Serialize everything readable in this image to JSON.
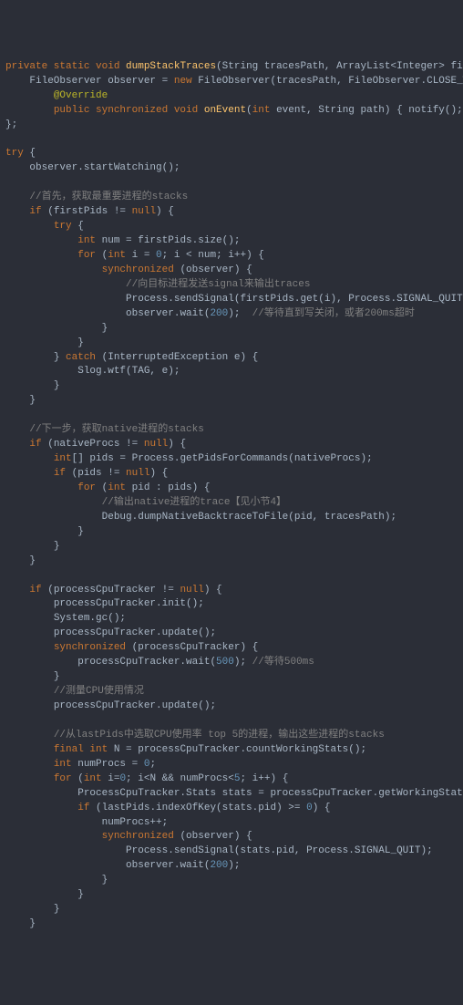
{
  "lines": [
    {
      "i": 0,
      "segs": [
        {
          "c": "kw",
          "t": "private static void "
        },
        {
          "c": "fn",
          "t": "dumpStackTraces"
        },
        {
          "c": "id",
          "t": "(String tracesPath, ArrayList<Integer> firstPids, ProcessC"
        }
      ]
    },
    {
      "i": 1,
      "segs": [
        {
          "c": "id",
          "t": "FileObserver observer = "
        },
        {
          "c": "kw",
          "t": "new "
        },
        {
          "c": "id",
          "t": "FileObserver(tracesPath, FileObserver.CLOSE_WRITE) {"
        }
      ]
    },
    {
      "i": 2,
      "segs": [
        {
          "c": "ann",
          "t": "@Override"
        }
      ]
    },
    {
      "i": 2,
      "segs": [
        {
          "c": "kw",
          "t": "public synchronized void "
        },
        {
          "c": "fn",
          "t": "onEvent"
        },
        {
          "c": "id",
          "t": "("
        },
        {
          "c": "kw",
          "t": "int "
        },
        {
          "c": "id",
          "t": "event, String path) { notify(); }"
        }
      ]
    },
    {
      "i": 0,
      "segs": [
        {
          "c": "id",
          "t": "};"
        }
      ]
    },
    {
      "i": 0,
      "segs": [
        {
          "c": "id",
          "t": " "
        }
      ]
    },
    {
      "i": 0,
      "segs": [
        {
          "c": "kw",
          "t": "try "
        },
        {
          "c": "id",
          "t": "{"
        }
      ]
    },
    {
      "i": 1,
      "segs": [
        {
          "c": "id",
          "t": "observer.startWatching();"
        }
      ]
    },
    {
      "i": 1,
      "segs": [
        {
          "c": "id",
          "t": " "
        }
      ]
    },
    {
      "i": 1,
      "segs": [
        {
          "c": "cm",
          "t": "//首先，获取最重要进程的stacks"
        }
      ]
    },
    {
      "i": 1,
      "segs": [
        {
          "c": "kw",
          "t": "if "
        },
        {
          "c": "id",
          "t": "(firstPids != "
        },
        {
          "c": "kw",
          "t": "null"
        },
        {
          "c": "id",
          "t": ") {"
        }
      ]
    },
    {
      "i": 2,
      "segs": [
        {
          "c": "kw",
          "t": "try "
        },
        {
          "c": "id",
          "t": "{"
        }
      ]
    },
    {
      "i": 3,
      "segs": [
        {
          "c": "kw",
          "t": "int "
        },
        {
          "c": "id",
          "t": "num = firstPids.size();"
        }
      ]
    },
    {
      "i": 3,
      "segs": [
        {
          "c": "kw",
          "t": "for "
        },
        {
          "c": "id",
          "t": "("
        },
        {
          "c": "kw",
          "t": "int "
        },
        {
          "c": "id",
          "t": "i = "
        },
        {
          "c": "num",
          "t": "0"
        },
        {
          "c": "id",
          "t": "; i < num; i++) {"
        }
      ]
    },
    {
      "i": 4,
      "segs": [
        {
          "c": "kw",
          "t": "synchronized "
        },
        {
          "c": "id",
          "t": "(observer) {"
        }
      ]
    },
    {
      "i": 5,
      "segs": [
        {
          "c": "cm",
          "t": "//向目标进程发送signal来输出traces"
        }
      ]
    },
    {
      "i": 5,
      "segs": [
        {
          "c": "id",
          "t": "Process.sendSignal(firstPids.get(i), Process.SIGNAL_QUIT);"
        }
      ]
    },
    {
      "i": 5,
      "segs": [
        {
          "c": "id",
          "t": "observer.wait("
        },
        {
          "c": "num",
          "t": "200"
        },
        {
          "c": "id",
          "t": ");  "
        },
        {
          "c": "cm",
          "t": "//等待直到写关闭，或者200ms超时"
        }
      ]
    },
    {
      "i": 4,
      "segs": [
        {
          "c": "id",
          "t": "}"
        }
      ]
    },
    {
      "i": 3,
      "segs": [
        {
          "c": "id",
          "t": "}"
        }
      ]
    },
    {
      "i": 2,
      "segs": [
        {
          "c": "id",
          "t": "} "
        },
        {
          "c": "kw",
          "t": "catch "
        },
        {
          "c": "id",
          "t": "(InterruptedException e) {"
        }
      ]
    },
    {
      "i": 3,
      "segs": [
        {
          "c": "id",
          "t": "Slog.wtf(TAG, e);"
        }
      ]
    },
    {
      "i": 2,
      "segs": [
        {
          "c": "id",
          "t": "}"
        }
      ]
    },
    {
      "i": 1,
      "segs": [
        {
          "c": "id",
          "t": "}"
        }
      ]
    },
    {
      "i": 1,
      "segs": [
        {
          "c": "id",
          "t": " "
        }
      ]
    },
    {
      "i": 1,
      "segs": [
        {
          "c": "cm",
          "t": "//下一步，获取native进程的stacks"
        }
      ]
    },
    {
      "i": 1,
      "segs": [
        {
          "c": "kw",
          "t": "if "
        },
        {
          "c": "id",
          "t": "(nativeProcs != "
        },
        {
          "c": "kw",
          "t": "null"
        },
        {
          "c": "id",
          "t": ") {"
        }
      ]
    },
    {
      "i": 2,
      "segs": [
        {
          "c": "kw",
          "t": "int"
        },
        {
          "c": "id",
          "t": "[] pids = Process.getPidsForCommands(nativeProcs);"
        }
      ]
    },
    {
      "i": 2,
      "segs": [
        {
          "c": "kw",
          "t": "if "
        },
        {
          "c": "id",
          "t": "(pids != "
        },
        {
          "c": "kw",
          "t": "null"
        },
        {
          "c": "id",
          "t": ") {"
        }
      ]
    },
    {
      "i": 3,
      "segs": [
        {
          "c": "kw",
          "t": "for "
        },
        {
          "c": "id",
          "t": "("
        },
        {
          "c": "kw",
          "t": "int "
        },
        {
          "c": "id",
          "t": "pid : pids) {"
        }
      ]
    },
    {
      "i": 4,
      "segs": [
        {
          "c": "cm",
          "t": "//输出native进程的trace【见小节4】"
        }
      ]
    },
    {
      "i": 4,
      "segs": [
        {
          "c": "id",
          "t": "Debug.dumpNativeBacktraceToFile(pid, tracesPath);"
        }
      ]
    },
    {
      "i": 3,
      "segs": [
        {
          "c": "id",
          "t": "}"
        }
      ]
    },
    {
      "i": 2,
      "segs": [
        {
          "c": "id",
          "t": "}"
        }
      ]
    },
    {
      "i": 1,
      "segs": [
        {
          "c": "id",
          "t": "}"
        }
      ]
    },
    {
      "i": 1,
      "segs": [
        {
          "c": "id",
          "t": " "
        }
      ]
    },
    {
      "i": 1,
      "segs": [
        {
          "c": "kw",
          "t": "if "
        },
        {
          "c": "id",
          "t": "(processCpuTracker != "
        },
        {
          "c": "kw",
          "t": "null"
        },
        {
          "c": "id",
          "t": ") {"
        }
      ]
    },
    {
      "i": 2,
      "segs": [
        {
          "c": "id",
          "t": "processCpuTracker.init();"
        }
      ]
    },
    {
      "i": 2,
      "segs": [
        {
          "c": "id",
          "t": "System.gc();"
        }
      ]
    },
    {
      "i": 2,
      "segs": [
        {
          "c": "id",
          "t": "processCpuTracker.update();"
        }
      ]
    },
    {
      "i": 2,
      "segs": [
        {
          "c": "kw",
          "t": "synchronized "
        },
        {
          "c": "id",
          "t": "(processCpuTracker) {"
        }
      ]
    },
    {
      "i": 3,
      "segs": [
        {
          "c": "id",
          "t": "processCpuTracker.wait("
        },
        {
          "c": "num",
          "t": "500"
        },
        {
          "c": "id",
          "t": "); "
        },
        {
          "c": "cm",
          "t": "//等待500ms"
        }
      ]
    },
    {
      "i": 2,
      "segs": [
        {
          "c": "id",
          "t": "}"
        }
      ]
    },
    {
      "i": 2,
      "segs": [
        {
          "c": "cm",
          "t": "//测量CPU使用情况"
        }
      ]
    },
    {
      "i": 2,
      "segs": [
        {
          "c": "id",
          "t": "processCpuTracker.update();"
        }
      ]
    },
    {
      "i": 2,
      "segs": [
        {
          "c": "id",
          "t": " "
        }
      ]
    },
    {
      "i": 2,
      "segs": [
        {
          "c": "cm",
          "t": "//从lastPids中选取CPU使用率 top 5的进程，输出这些进程的stacks"
        }
      ]
    },
    {
      "i": 2,
      "segs": [
        {
          "c": "kw",
          "t": "final int "
        },
        {
          "c": "id",
          "t": "N = processCpuTracker.countWorkingStats();"
        }
      ]
    },
    {
      "i": 2,
      "segs": [
        {
          "c": "kw",
          "t": "int "
        },
        {
          "c": "id",
          "t": "numProcs = "
        },
        {
          "c": "num",
          "t": "0"
        },
        {
          "c": "id",
          "t": ";"
        }
      ]
    },
    {
      "i": 2,
      "segs": [
        {
          "c": "kw",
          "t": "for "
        },
        {
          "c": "id",
          "t": "("
        },
        {
          "c": "kw",
          "t": "int "
        },
        {
          "c": "id",
          "t": "i="
        },
        {
          "c": "num",
          "t": "0"
        },
        {
          "c": "id",
          "t": "; i<N && numProcs<"
        },
        {
          "c": "num",
          "t": "5"
        },
        {
          "c": "id",
          "t": "; i++) {"
        }
      ]
    },
    {
      "i": 3,
      "segs": [
        {
          "c": "id",
          "t": "ProcessCpuTracker.Stats stats = processCpuTracker.getWorkingStats(i);"
        }
      ]
    },
    {
      "i": 3,
      "segs": [
        {
          "c": "kw",
          "t": "if "
        },
        {
          "c": "id",
          "t": "(lastPids.indexOfKey(stats.pid) >= "
        },
        {
          "c": "num",
          "t": "0"
        },
        {
          "c": "id",
          "t": ") {"
        }
      ]
    },
    {
      "i": 4,
      "segs": [
        {
          "c": "id",
          "t": "numProcs++;"
        }
      ]
    },
    {
      "i": 4,
      "segs": [
        {
          "c": "kw",
          "t": "synchronized "
        },
        {
          "c": "id",
          "t": "(observer) {"
        }
      ]
    },
    {
      "i": 5,
      "segs": [
        {
          "c": "id",
          "t": "Process.sendSignal(stats.pid, Process.SIGNAL_QUIT);"
        }
      ]
    },
    {
      "i": 5,
      "segs": [
        {
          "c": "id",
          "t": "observer.wait("
        },
        {
          "c": "num",
          "t": "200"
        },
        {
          "c": "id",
          "t": ");"
        }
      ]
    },
    {
      "i": 4,
      "segs": [
        {
          "c": "id",
          "t": "}"
        }
      ]
    },
    {
      "i": 3,
      "segs": [
        {
          "c": "id",
          "t": "}"
        }
      ]
    },
    {
      "i": 2,
      "segs": [
        {
          "c": "id",
          "t": "}"
        }
      ]
    },
    {
      "i": 1,
      "segs": [
        {
          "c": "id",
          "t": "}"
        }
      ]
    }
  ],
  "indent_unit": "    "
}
